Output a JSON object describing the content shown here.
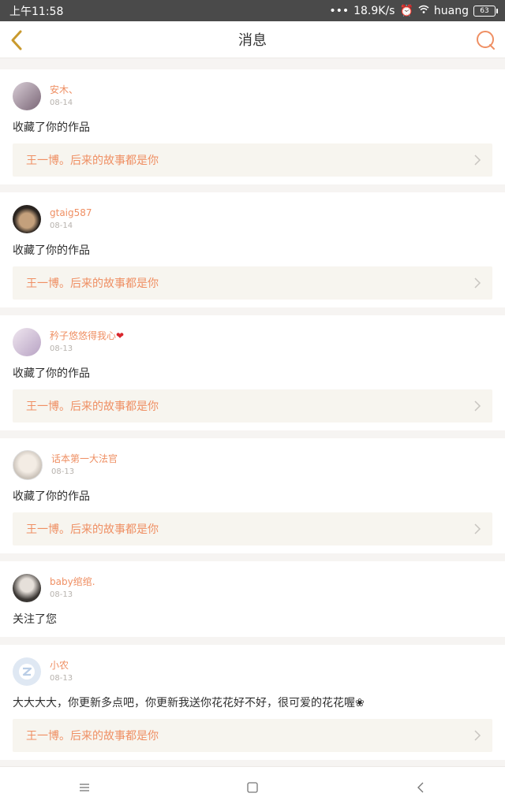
{
  "status_bar": {
    "time": "上午11:58",
    "network_speed": "18.9K/s",
    "wifi_name": "huang",
    "battery": "63"
  },
  "header": {
    "title": "消息"
  },
  "messages": [
    {
      "username": "安木、",
      "time": "08-14",
      "action": "收藏了你的作品",
      "work_title": "王一博。后来的故事都是你"
    },
    {
      "username": "gtaig587",
      "time": "08-14",
      "action": "收藏了你的作品",
      "work_title": "王一博。后来的故事都是你"
    },
    {
      "username": "矜子悠悠得我心",
      "time": "08-13",
      "action": "收藏了你的作品",
      "work_title": "王一博。后来的故事都是你"
    },
    {
      "username": "话本第一大法官",
      "time": "08-13",
      "action": "收藏了你的作品",
      "work_title": "王一博。后来的故事都是你"
    },
    {
      "username": "baby绾绾.",
      "time": "08-13",
      "action": "关注了您"
    },
    {
      "username": "小农",
      "time": "08-13",
      "action": "大大大大，你更新多点吧，你更新我送你花花好不好，很可爱的花花喔❀",
      "work_title": "王一博。后来的故事都是你"
    }
  ],
  "colors": {
    "accent": "#ef8f63",
    "icon_gold": "#c99a2e"
  },
  "icons": {
    "back": "chevron-left-icon",
    "search": "search-icon",
    "work_arrow": "chevron-right-icon",
    "nav_menu": "menu-icon",
    "nav_home": "home-square-icon",
    "nav_back": "back-icon"
  }
}
